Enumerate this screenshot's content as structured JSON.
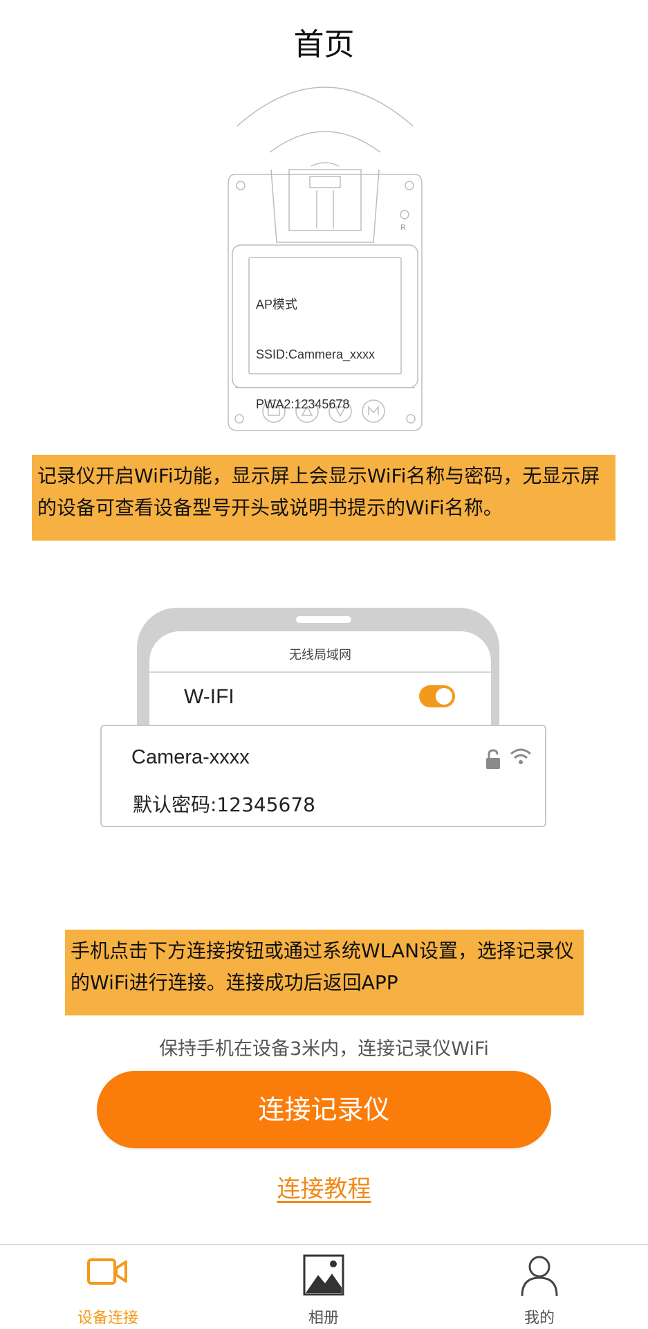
{
  "header": {
    "title": "首页"
  },
  "device": {
    "screen_lines": [
      "AP模式",
      "SSID:Cammera_xxxx",
      "PWA2:12345678"
    ],
    "side_label": "R",
    "button_icons": [
      "play-icon",
      "up-arrow-icon",
      "down-arrow-icon",
      "m-icon"
    ]
  },
  "hints": {
    "step1": "记录仪开启WiFi功能，显示屏上会显示WiFi名称与密码，无显示屏的设备可查看设备型号开头或说明书提示的WiFi名称。",
    "step2": "手机点击下方连接按钮或通过系统WLAN设置，选择记录仪的WiFi进行连接。连接成功后返回APP"
  },
  "phone": {
    "header": "无线局域网",
    "wifi_label": "W-IFI",
    "wifi_enabled": true,
    "network_name": "Camera-xxxx",
    "default_password": "默认密码:12345678"
  },
  "connect": {
    "hint": "保持手机在设备3米内，连接记录仪WiFi",
    "button_label": "连接记录仪",
    "tutorial_label": "连接教程"
  },
  "tabbar": {
    "items": [
      {
        "label": "设备连接",
        "icon": "video-camera-icon",
        "active": true
      },
      {
        "label": "相册",
        "icon": "image-icon",
        "active": false
      },
      {
        "label": "我的",
        "icon": "person-icon",
        "active": false
      }
    ]
  },
  "colors": {
    "accent": "#fa7c0a",
    "hint_background": "#f7b142",
    "tab_active": "#f39a1b"
  }
}
